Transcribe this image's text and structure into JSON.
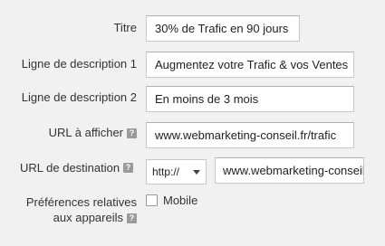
{
  "fields": {
    "titre": {
      "label": "Titre",
      "value": "30% de Trafic en 90 jours"
    },
    "ligne1": {
      "label": "Ligne de description 1",
      "value": "Augmentez votre Trafic & vos Ventes"
    },
    "ligne2": {
      "label": "Ligne de description 2",
      "value": "En moins de 3 mois"
    },
    "url_afficher": {
      "label": "URL à afficher",
      "value": "www.webmarketing-conseil.fr/trafic"
    },
    "url_destination": {
      "label": "URL de destination",
      "protocol": "http://",
      "value": "www.webmarketing-conseil"
    },
    "preferences": {
      "label_line1": "Préférences relatives",
      "label_line2": "aux appareils",
      "option_label": "Mobile"
    }
  },
  "help_glyph": "?",
  "icons": {
    "help": "help-icon",
    "dropdown": "chevron-down-icon"
  }
}
